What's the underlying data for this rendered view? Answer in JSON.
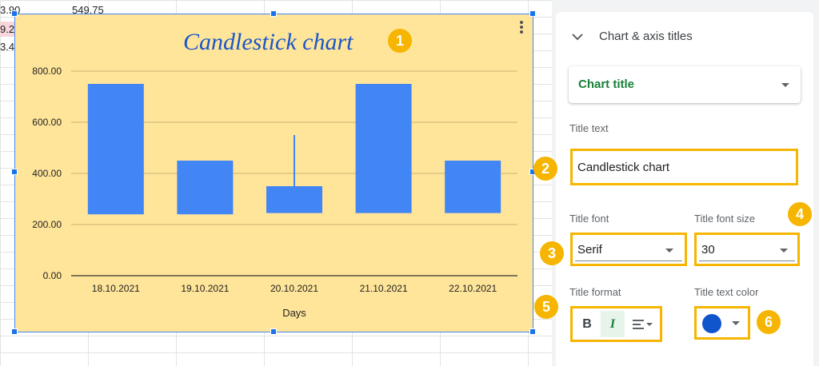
{
  "spreadsheet": {
    "visible_cells": [
      "3.90",
      "549.75",
      "9.2",
      "3.4"
    ]
  },
  "chart": {
    "title": "Candlestick chart",
    "menu_icon": "kebab-vertical-icon"
  },
  "chart_data": {
    "type": "candlestick",
    "title": "Candlestick chart",
    "xlabel": "Days",
    "ylabel": "",
    "ylim": [
      0,
      800
    ],
    "yticks": [
      "0.00",
      "200.00",
      "400.00",
      "600.00",
      "800.00"
    ],
    "categories": [
      "18.10.2021",
      "19.10.2021",
      "20.10.2021",
      "21.10.2021",
      "22.10.2021"
    ],
    "candles": [
      {
        "low": 240,
        "open": 240,
        "close": 750,
        "high": 750
      },
      {
        "low": 240,
        "open": 240,
        "close": 450,
        "high": 450
      },
      {
        "low": 245,
        "open": 245,
        "close": 350,
        "high": 550
      },
      {
        "low": 245,
        "open": 245,
        "close": 750,
        "high": 750
      },
      {
        "low": 245,
        "open": 245,
        "close": 450,
        "high": 450
      }
    ],
    "colors": {
      "candle": "#4285f4",
      "background": "#ffe599",
      "title": "#1a56c9",
      "grid": "#c8b478"
    },
    "grid": true
  },
  "badges": [
    "1",
    "2",
    "3",
    "4",
    "5",
    "6"
  ],
  "panel": {
    "section_title": "Chart & axis titles",
    "title_type": "Chart title",
    "title_text_label": "Title text",
    "title_text_value": "Candlestick chart",
    "title_font_label": "Title font",
    "title_font_value": "Serif",
    "title_font_size_label": "Title font size",
    "title_font_size_value": "30",
    "title_format_label": "Title format",
    "format_buttons": [
      "B",
      "I"
    ],
    "title_text_color_label": "Title text color",
    "title_text_color": "#1155cc"
  },
  "colors": {
    "badge": "#f6b500",
    "accent_green": "#188038",
    "selection": "#1a73e8"
  }
}
